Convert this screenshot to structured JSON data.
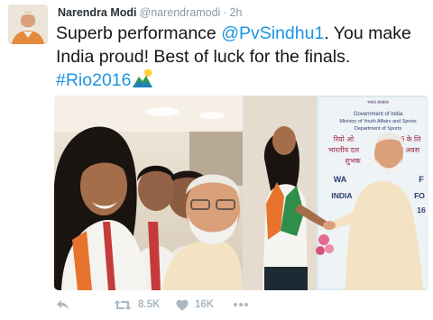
{
  "author": {
    "name": "Narendra Modi",
    "handle": "@narendramodi",
    "separator": "·",
    "time": "2h"
  },
  "tweet": {
    "text_parts": [
      {
        "text": "Superb performance ",
        "type": "plain"
      },
      {
        "text": "@PvSindhu1",
        "type": "mention"
      },
      {
        "text": ". You make India proud! Best of luck for the finals. ",
        "type": "plain"
      },
      {
        "text": "#Rio2016",
        "type": "hashtag"
      }
    ],
    "emoji": "rio2016-emoji-icon"
  },
  "media": {
    "right_photo_sign": {
      "line1": "भारत सरकार",
      "line2": "Government of India",
      "line3": "Ministry of Youth Affairs and Sports",
      "line4": "Department of Sports",
      "line5": "रियो ओ",
      "line6": "16 के लि",
      "line7": "भारतीय दल",
      "line8": "के अवस",
      "line9": "शुभक",
      "line10": "WA",
      "line11": "F",
      "line12": "INDIA",
      "line13": "FO",
      "line14": "16"
    }
  },
  "actions": {
    "reply_icon": "reply-icon",
    "retweet_icon": "retweet-icon",
    "retweet_count": "8.5K",
    "like_icon": "heart-icon",
    "like_count": "16K",
    "more_icon": "more-dots-icon"
  },
  "colors": {
    "link": "#1b95e0",
    "muted": "#8899a6",
    "action": "#aab8c2",
    "text": "#14171a"
  }
}
